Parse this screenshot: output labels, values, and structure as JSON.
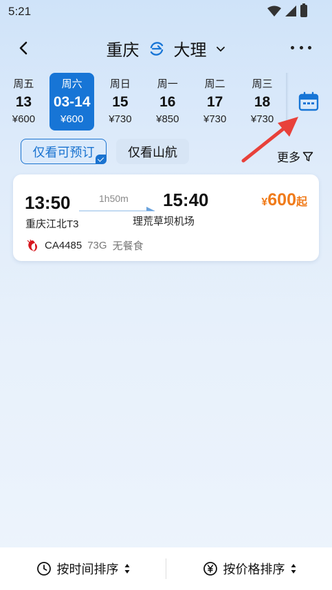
{
  "status": {
    "time": "5:21"
  },
  "header": {
    "from": "重庆",
    "to": "大理"
  },
  "dates": [
    {
      "weekday": "周五",
      "day": "13",
      "price": "¥600"
    },
    {
      "weekday": "周六",
      "day": "03-14",
      "price": "¥600",
      "selected": true
    },
    {
      "weekday": "周日",
      "day": "15",
      "price": "¥730"
    },
    {
      "weekday": "周一",
      "day": "16",
      "price": "¥850"
    },
    {
      "weekday": "周二",
      "day": "17",
      "price": "¥730"
    },
    {
      "weekday": "周三",
      "day": "18",
      "price": "¥730"
    }
  ],
  "filters": {
    "bookable_only": "仅看可预订",
    "shandong_only": "仅看山航",
    "more": "更多"
  },
  "flight": {
    "dep_time": "13:50",
    "dep_airport": "重庆江北T3",
    "duration": "1h50m",
    "arr_time": "15:40",
    "arr_airport": "理荒草坝机场",
    "price_currency": "¥",
    "price_value": "600",
    "price_suffix": "起",
    "flight_no": "CA4485",
    "aircraft": "73G",
    "meal": "无餐食"
  },
  "sort": {
    "by_time": "按时间排序",
    "by_price": "按价格排序"
  },
  "colors": {
    "accent": "#1775d6",
    "price": "#f07b1a",
    "annotation": "#e8413a"
  }
}
